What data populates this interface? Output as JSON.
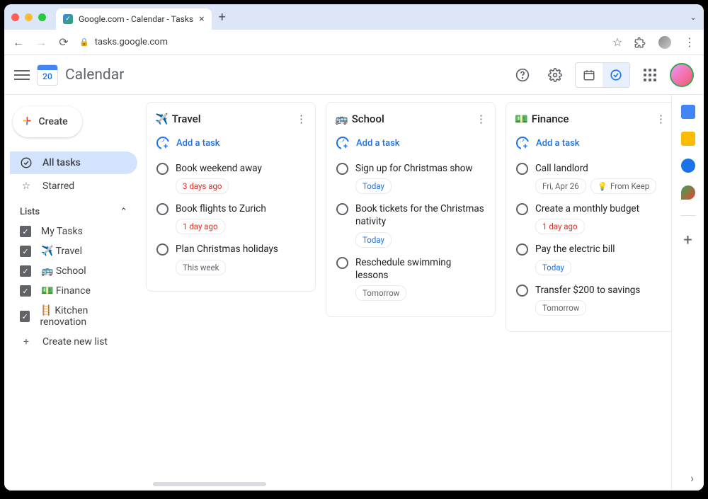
{
  "browser": {
    "tab_title": "Google.com - Calendar - Tasks",
    "url": "tasks.google.com"
  },
  "header": {
    "app_name": "Calendar",
    "logo_day": "20"
  },
  "sidebar": {
    "create_label": "Create",
    "all_tasks": "All tasks",
    "starred": "Starred",
    "lists_header": "Lists",
    "lists": [
      {
        "emoji": "",
        "name": "My Tasks"
      },
      {
        "emoji": "✈️",
        "name": "Travel"
      },
      {
        "emoji": "🚌",
        "name": "School"
      },
      {
        "emoji": "💵",
        "name": "Finance"
      },
      {
        "emoji": "🪜",
        "name": "Kitchen renovation"
      }
    ],
    "create_list": "Create new list"
  },
  "columns": [
    {
      "emoji": "✈️",
      "title": "Travel",
      "add_label": "Add a task",
      "tasks": [
        {
          "title": "Book weekend away",
          "pills": [
            {
              "text": "3 days ago",
              "tone": "red"
            }
          ]
        },
        {
          "title": "Book flights to Zurich",
          "pills": [
            {
              "text": "1 day ago",
              "tone": "red"
            }
          ]
        },
        {
          "title": "Plan Christmas holidays",
          "pills": [
            {
              "text": "This week",
              "tone": "gray"
            }
          ]
        }
      ]
    },
    {
      "emoji": "🚌",
      "title": "School",
      "add_label": "Add a task",
      "tasks": [
        {
          "title": "Sign up for Christmas show",
          "pills": [
            {
              "text": "Today",
              "tone": "blue"
            }
          ]
        },
        {
          "title": "Book tickets for the Christmas nativity",
          "pills": [
            {
              "text": "Today",
              "tone": "blue"
            }
          ]
        },
        {
          "title": "Reschedule swimming lessons",
          "pills": [
            {
              "text": "Tomorrow",
              "tone": "gray"
            }
          ]
        }
      ]
    },
    {
      "emoji": "💵",
      "title": "Finance",
      "add_label": "Add a task",
      "tasks": [
        {
          "title": "Call landlord",
          "pills": [
            {
              "text": "Fri, Apr 26",
              "tone": "gray"
            },
            {
              "text": "From Keep",
              "tone": "gray",
              "icon": "keep"
            }
          ]
        },
        {
          "title": "Create a monthly budget",
          "pills": [
            {
              "text": "1 day ago",
              "tone": "red"
            }
          ]
        },
        {
          "title": "Pay the electric bill",
          "pills": [
            {
              "text": "Today",
              "tone": "blue"
            }
          ]
        },
        {
          "title": "Transfer $200 to savings",
          "pills": [
            {
              "text": "Tomorrow",
              "tone": "gray"
            }
          ]
        }
      ]
    }
  ]
}
